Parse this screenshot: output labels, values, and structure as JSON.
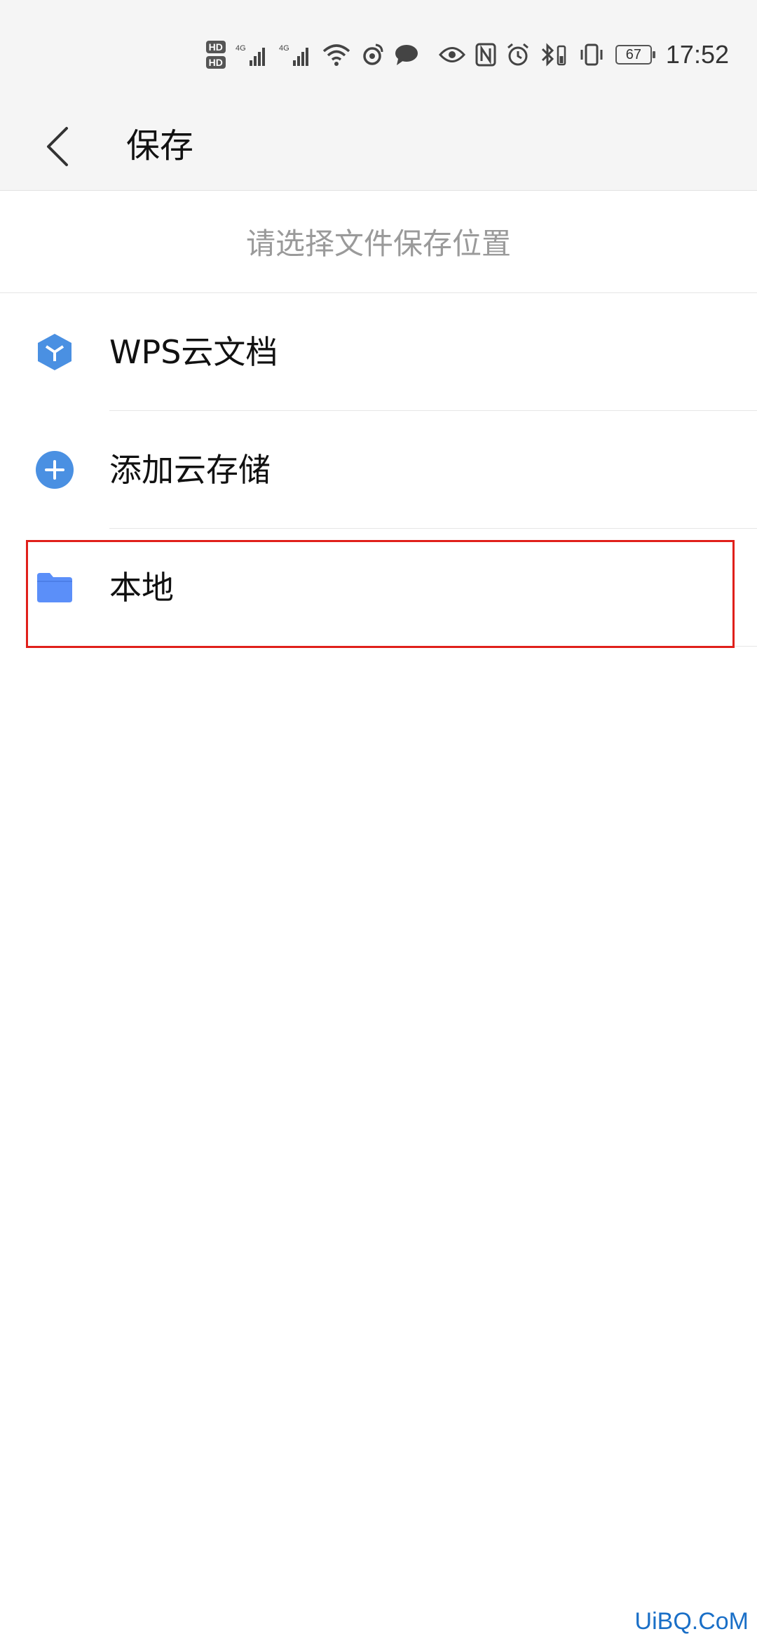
{
  "status_bar": {
    "hd1": "HD",
    "hd2": "HD",
    "net1": "4G",
    "net2": "4G",
    "battery": "67",
    "time": "17:52"
  },
  "toolbar": {
    "title": "保存"
  },
  "prompt": "请选择文件保存位置",
  "list": {
    "items": [
      {
        "label": "WPS云文档",
        "icon": "cube-icon"
      },
      {
        "label": "添加云存储",
        "icon": "plus-circle-icon"
      },
      {
        "label": "本地",
        "icon": "folder-icon"
      }
    ]
  },
  "colors": {
    "accent_blue": "#4a90e2",
    "folder_blue": "#5b8ff9",
    "highlight_red": "#e0201b",
    "watermark_blue": "#1a6fc7"
  },
  "watermark": "UiBQ.CoM"
}
